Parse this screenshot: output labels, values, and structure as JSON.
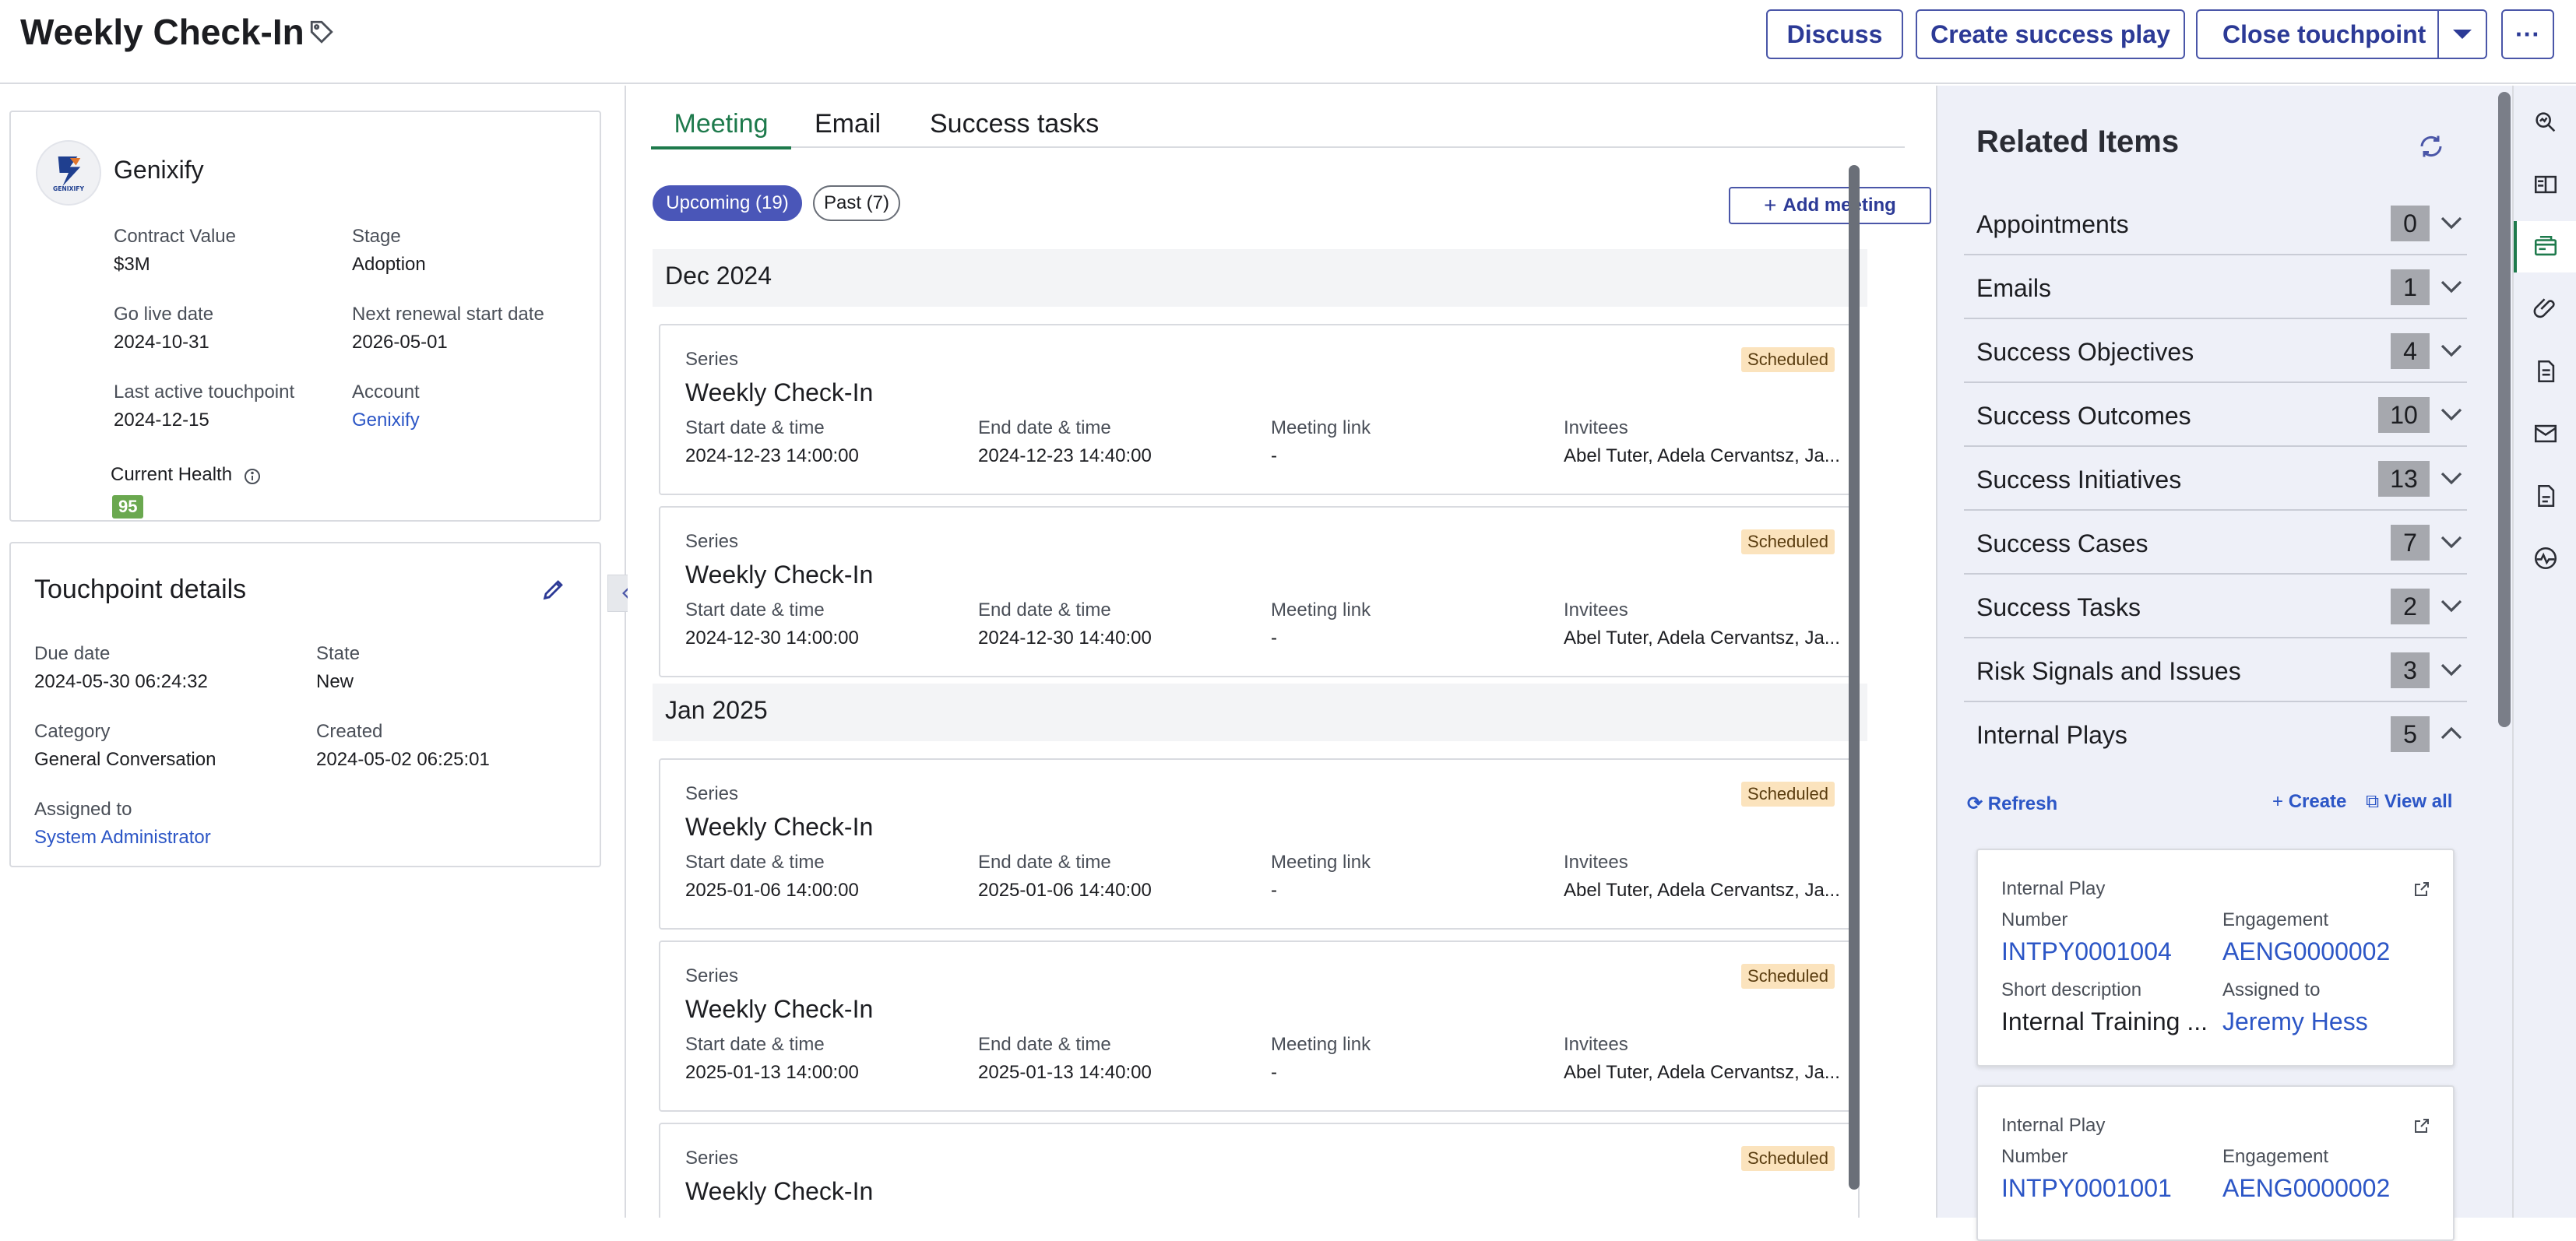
{
  "header": {
    "title": "Weekly Check-In",
    "tag_icon": "tag-icon",
    "buttons": {
      "discuss": "Discuss",
      "create_success_play": "Create success play",
      "close_touchpoint": "Close touchpoint",
      "more": "···"
    }
  },
  "account": {
    "name": "Genixify",
    "logo_text": "GENIXIFY",
    "fields": {
      "contract_value_label": "Contract Value",
      "contract_value": "$3M",
      "stage_label": "Stage",
      "stage": "Adoption",
      "go_live_label": "Go live date",
      "go_live": "2024-10-31",
      "renewal_label": "Next renewal start date",
      "renewal": "2026-05-01",
      "last_active_label": "Last active touchpoint",
      "last_active": "2024-12-15",
      "account_label": "Account",
      "account_link": "Genixify",
      "health_label": "Current Health",
      "health_value": "95"
    }
  },
  "touchpoint": {
    "title": "Touchpoint details",
    "due_label": "Due date",
    "due": "2024-05-30 06:24:32",
    "state_label": "State",
    "state": "New",
    "category_label": "Category",
    "category": "General Conversation",
    "created_label": "Created",
    "created": "2024-05-02 06:25:01",
    "assigned_label": "Assigned to",
    "assigned": "System Administrator"
  },
  "center": {
    "tabs": [
      "Meeting",
      "Email",
      "Success tasks"
    ],
    "active_tab": "Meeting",
    "pill_upcoming": "Upcoming (19)",
    "pill_past": "Past (7)",
    "add_meeting": "Add meeting",
    "col_labels": {
      "start": "Start date & time",
      "end": "End date & time",
      "link": "Meeting link",
      "invitees": "Invitees"
    },
    "months": [
      {
        "label": "Dec 2024",
        "meetings": [
          {
            "series": "Series",
            "title": "Weekly Check-In",
            "status": "Scheduled",
            "start": "2024-12-23 14:00:00",
            "end": "2024-12-23 14:40:00",
            "link": "-",
            "invitees": "Abel Tuter, Adela Cervantsz, Ja..."
          },
          {
            "series": "Series",
            "title": "Weekly Check-In",
            "status": "Scheduled",
            "start": "2024-12-30 14:00:00",
            "end": "2024-12-30 14:40:00",
            "link": "-",
            "invitees": "Abel Tuter, Adela Cervantsz, Ja..."
          }
        ]
      },
      {
        "label": "Jan 2025",
        "meetings": [
          {
            "series": "Series",
            "title": "Weekly Check-In",
            "status": "Scheduled",
            "start": "2025-01-06 14:00:00",
            "end": "2025-01-06 14:40:00",
            "link": "-",
            "invitees": "Abel Tuter, Adela Cervantsz, Ja..."
          },
          {
            "series": "Series",
            "title": "Weekly Check-In",
            "status": "Scheduled",
            "start": "2025-01-13 14:00:00",
            "end": "2025-01-13 14:40:00",
            "link": "-",
            "invitees": "Abel Tuter, Adela Cervantsz, Ja..."
          },
          {
            "series": "Series",
            "title": "Weekly Check-In",
            "status": "Scheduled",
            "start": "",
            "end": "",
            "link": "",
            "invitees": ""
          }
        ]
      }
    ]
  },
  "related": {
    "title": "Related Items",
    "items": [
      {
        "name": "Appointments",
        "count": "0",
        "expanded": false
      },
      {
        "name": "Emails",
        "count": "1",
        "expanded": false
      },
      {
        "name": "Success Objectives",
        "count": "4",
        "expanded": false
      },
      {
        "name": "Success Outcomes",
        "count": "10",
        "expanded": false
      },
      {
        "name": "Success Initiatives",
        "count": "13",
        "expanded": false
      },
      {
        "name": "Success Cases",
        "count": "7",
        "expanded": false
      },
      {
        "name": "Success Tasks",
        "count": "2",
        "expanded": false
      },
      {
        "name": "Risk Signals and Issues",
        "count": "3",
        "expanded": false
      },
      {
        "name": "Internal Plays",
        "count": "5",
        "expanded": true
      }
    ],
    "actions": {
      "refresh": "Refresh",
      "create": "Create",
      "view_all": "View all"
    },
    "plays": [
      {
        "type": "Internal Play",
        "number_label": "Number",
        "number": "INTPY0001004",
        "engagement_label": "Engagement",
        "engagement": "AENG0000002",
        "desc_label": "Short description",
        "desc": "Internal Training ...",
        "assigned_label": "Assigned to",
        "assigned": "Jeremy Hess"
      },
      {
        "type": "Internal Play",
        "number_label": "Number",
        "number": "INTPY0001001",
        "engagement_label": "Engagement",
        "engagement": "AENG0000002"
      }
    ]
  },
  "rail_icons": [
    "search-insight-icon",
    "reader-icon",
    "related-items-icon",
    "attachment-icon",
    "document-icon",
    "email-icon",
    "note-icon",
    "activity-icon"
  ],
  "colors": {
    "accent": "#2c3a96",
    "active_tab": "#1e7a4c",
    "link": "#2c56c6",
    "health": "#6aa84f",
    "scheduled": "#fbe3bd"
  }
}
